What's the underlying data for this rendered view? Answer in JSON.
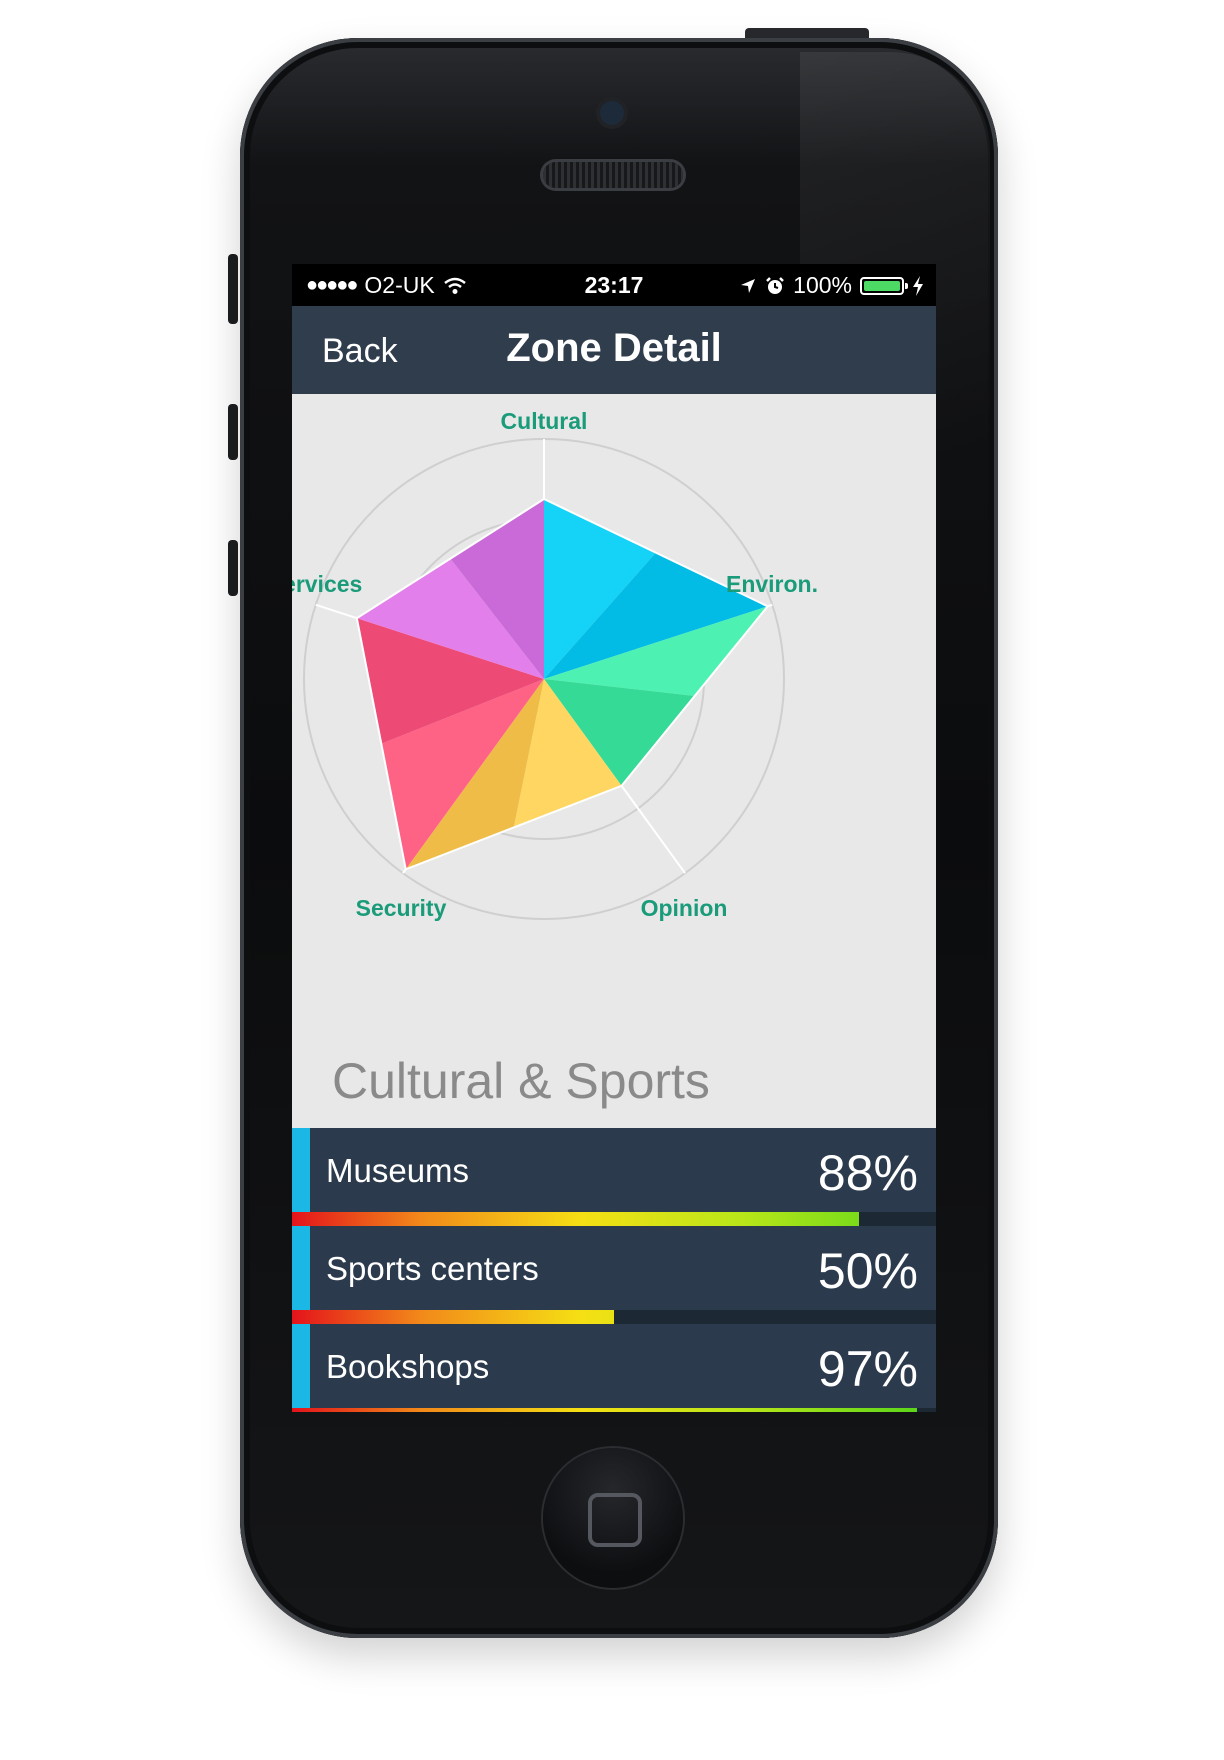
{
  "status_bar": {
    "signal": "●●●●●",
    "carrier": "O2-UK",
    "time": "23:17",
    "battery_percent": "100%",
    "battery_level": 1.0
  },
  "nav": {
    "back_label": "Back",
    "title": "Zone Detail"
  },
  "chart_data": {
    "type": "radar",
    "axes": [
      "Cultural",
      "Environ.",
      "Opinion",
      "Security",
      "Services"
    ],
    "values": [
      0.75,
      0.98,
      0.55,
      0.98,
      0.82
    ],
    "rings": 3,
    "segment_colors": [
      [
        "#14d3f7",
        "#03bce5"
      ],
      [
        "#4df2b2",
        "#34da96"
      ],
      [
        "#fed661",
        "#efbd47"
      ],
      [
        "#fe6386",
        "#ee4a76"
      ],
      [
        "#e27fea",
        "#ca6ad8"
      ]
    ],
    "label_color": "#1a9b7a"
  },
  "section": {
    "title": "Cultural & Sports"
  },
  "metrics": [
    {
      "label": "Museums",
      "value_text": "88%",
      "value": 0.88
    },
    {
      "label": "Sports centers",
      "value_text": "50%",
      "value": 0.5
    },
    {
      "label": "Bookshops",
      "value_text": "97%",
      "value": 0.97
    }
  ],
  "colors": {
    "nav_bg": "#2f3d4d",
    "row_bg": "#2b3a4c",
    "accent": "#1bb8e6",
    "screen_bg": "#e8e8e8"
  }
}
